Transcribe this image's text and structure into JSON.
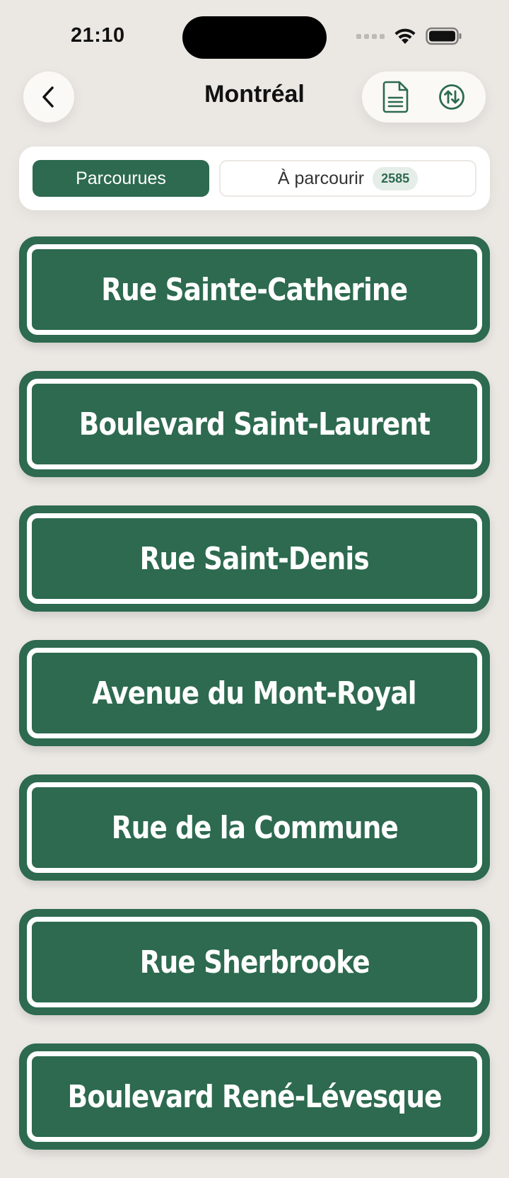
{
  "status_bar": {
    "time": "21:10"
  },
  "header": {
    "title": "Montréal",
    "back_icon": "chevron-left-icon",
    "actions": [
      {
        "icon": "document-icon"
      },
      {
        "icon": "sort-arrows-icon"
      }
    ]
  },
  "tabs": {
    "active_label": "Parcourues",
    "inactive_label": "À parcourir",
    "inactive_count": "2585"
  },
  "streets": [
    {
      "name": "Rue Sainte-Catherine"
    },
    {
      "name": "Boulevard Saint-Laurent"
    },
    {
      "name": "Rue Saint-Denis"
    },
    {
      "name": "Avenue du Mont-Royal"
    },
    {
      "name": "Rue de la Commune"
    },
    {
      "name": "Rue Sherbrooke"
    },
    {
      "name": "Boulevard René-Lévesque"
    }
  ],
  "colors": {
    "background": "#ebe8e4",
    "accent": "#2d6a4f",
    "sign_border": "#ffffff"
  }
}
